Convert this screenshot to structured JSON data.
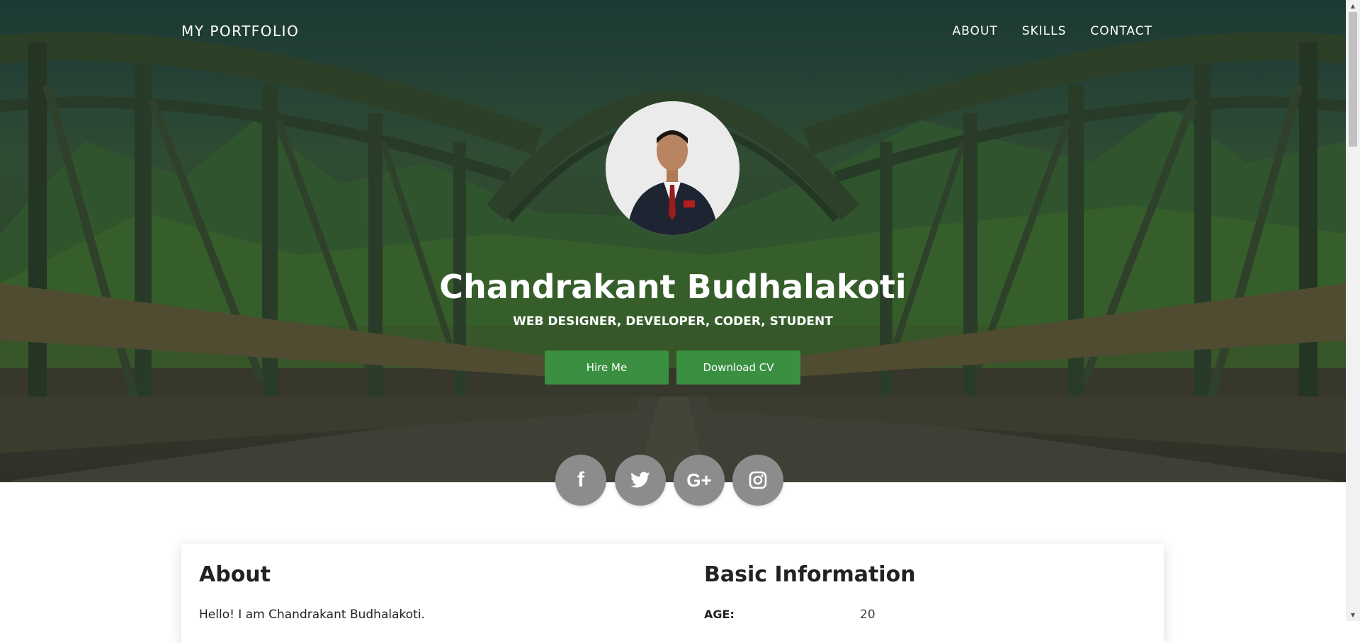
{
  "nav": {
    "brand": "MY PORTFOLIO",
    "links": [
      {
        "label": "ABOUT"
      },
      {
        "label": "SKILLS"
      },
      {
        "label": "CONTACT"
      }
    ]
  },
  "hero": {
    "name": "Chandrakant Budhalakoti",
    "subtitle": "WEB DESIGNER, DEVELOPER, CODER, STUDENT",
    "hire_label": "Hire Me",
    "cv_label": "Download CV"
  },
  "social": {
    "facebook": "f",
    "google_plus": "G+"
  },
  "about": {
    "title": "About",
    "text": "Hello! I am Chandrakant Budhalakoti."
  },
  "basic_info": {
    "title": "Basic Information",
    "age_label": "AGE:",
    "age_value": "20"
  },
  "colors": {
    "accent": "#3a9040",
    "social_bg": "#8c8c8c"
  }
}
